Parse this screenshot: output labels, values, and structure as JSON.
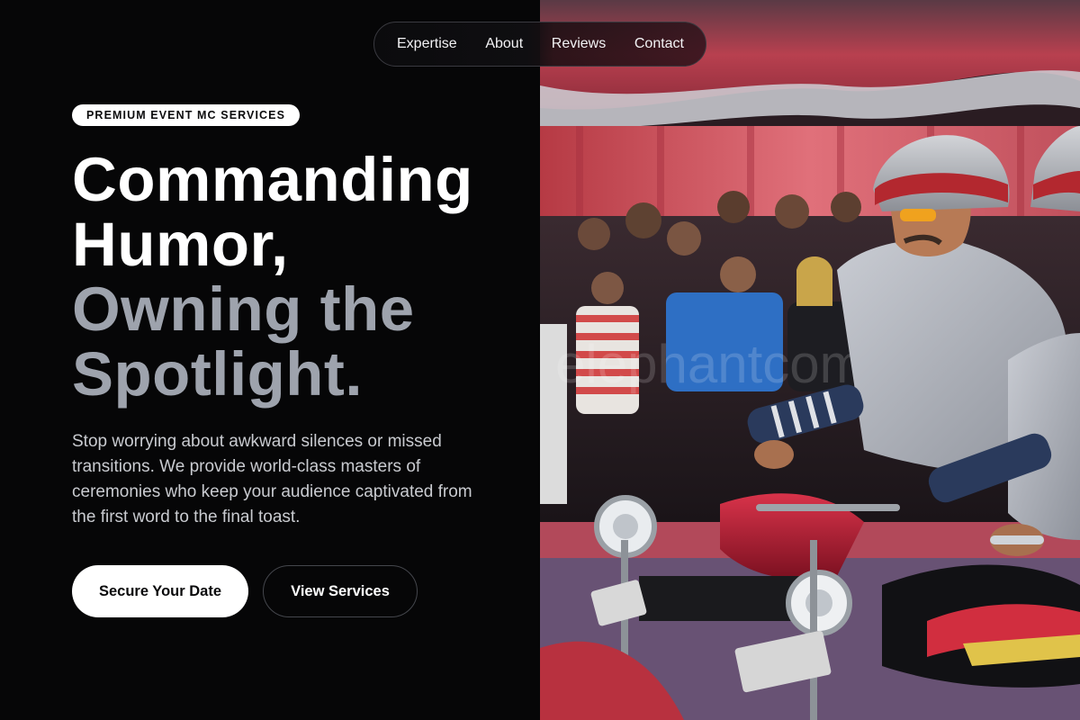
{
  "nav": {
    "items": [
      {
        "label": "Expertise"
      },
      {
        "label": "About"
      },
      {
        "label": "Reviews"
      },
      {
        "label": "Contact"
      }
    ]
  },
  "hero": {
    "badge": "PREMIUM EVENT MC SERVICES",
    "headline": {
      "line1": "Commanding",
      "line2": "Humor,",
      "line3": "Owning the",
      "line4": "Spotlight."
    },
    "lead": "Stop worrying about awkward silences or missed transitions. We provide world-class masters of ceremonies who keep your audience captivated from the first word to the final toast.",
    "primary_cta": "Secure Your Date",
    "secondary_cta": "View Services"
  },
  "photo": {
    "watermark": "elephantcomedy.com"
  },
  "colors": {
    "background": "#060607",
    "accent_white": "#ffffff",
    "headline_muted": "#9ea3ad",
    "body_text": "#c9cbd0"
  }
}
